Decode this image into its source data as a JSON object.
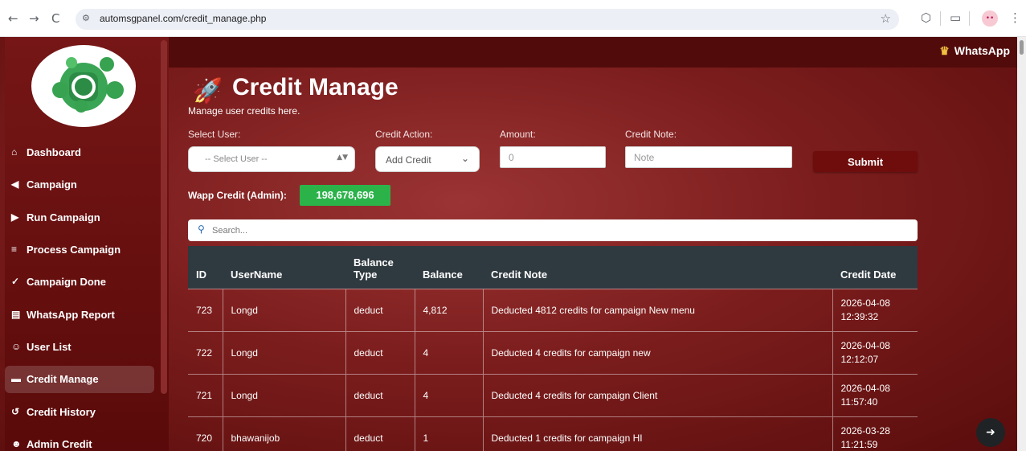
{
  "browser": {
    "back_icon": "←",
    "forward_icon": "→",
    "reload_icon": "C",
    "url": "automsgpanel.com/credit_manage.php",
    "avatar_text": "••"
  },
  "topbar": {
    "title": "WhatsApp"
  },
  "sidebar": {
    "items": [
      {
        "icon": "home-icon",
        "glyph": "⌂",
        "label": "Dashboard"
      },
      {
        "icon": "megaphone-icon",
        "glyph": "◀",
        "label": "Campaign"
      },
      {
        "icon": "play-circle-icon",
        "glyph": "▶",
        "label": "Run Campaign"
      },
      {
        "icon": "list-icon",
        "glyph": "≡",
        "label": "Process Campaign"
      },
      {
        "icon": "check-double-icon",
        "glyph": "✓",
        "label": "Campaign Done"
      },
      {
        "icon": "chart-icon",
        "glyph": "▤",
        "label": "WhatsApp Report"
      },
      {
        "icon": "users-icon",
        "glyph": "☺",
        "label": "User List"
      },
      {
        "icon": "credit-card-icon",
        "glyph": "▬",
        "label": "Credit Manage"
      },
      {
        "icon": "history-icon",
        "glyph": "↺",
        "label": "Credit History"
      },
      {
        "icon": "user-gear-icon",
        "glyph": "☻",
        "label": "Admin Credit"
      }
    ]
  },
  "page": {
    "title": "Credit Manage",
    "subtitle": "Manage user credits here."
  },
  "form": {
    "select_user_label": "Select User:",
    "select_user_value": "-- Select User --",
    "credit_action_label": "Credit Action:",
    "credit_action_value": "Add Credit",
    "amount_label": "Amount:",
    "amount_placeholder": "0",
    "note_label": "Credit Note:",
    "note_placeholder": "Note",
    "submit_label": "Submit"
  },
  "wapp_credit": {
    "label": "Wapp Credit (Admin):",
    "value": "198,678,696"
  },
  "search": {
    "placeholder": "Search..."
  },
  "table": {
    "headers": [
      "ID",
      "UserName",
      "Balance Type",
      "Balance",
      "Credit Note",
      "Credit Date"
    ],
    "rows": [
      {
        "id": "723",
        "username": "Longd",
        "balance_type": "deduct",
        "balance": "4,812",
        "note": "Deducted 4812 credits for campaign New menu",
        "date": "2026-04-08",
        "time": "12:39:32"
      },
      {
        "id": "722",
        "username": "Longd",
        "balance_type": "deduct",
        "balance": "4",
        "note": "Deducted 4 credits for campaign new",
        "date": "2026-04-08",
        "time": "12:12:07"
      },
      {
        "id": "721",
        "username": "Longd",
        "balance_type": "deduct",
        "balance": "4",
        "note": "Deducted 4 credits for campaign Client",
        "date": "2026-04-08",
        "time": "11:57:40"
      },
      {
        "id": "720",
        "username": "bhawanijob",
        "balance_type": "deduct",
        "balance": "1",
        "note": "Deducted 1 credits for campaign HI",
        "date": "2026-03-28",
        "time": "11:21:59"
      }
    ]
  },
  "colors": {
    "accent": "#7c1d1d",
    "credit_badge": "#2bb34a",
    "table_header": "#2f3940",
    "submit": "#6f0d0d"
  }
}
